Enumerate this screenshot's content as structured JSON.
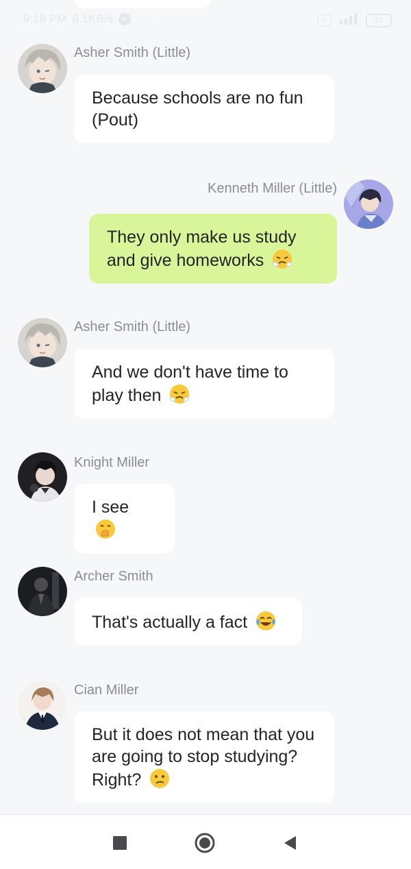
{
  "status_bar": {
    "time": "9:18 PM",
    "speed": "8.1KB/s",
    "dots": "···",
    "battery": "92"
  },
  "messages": [
    {
      "sender": "Asher Smith (Little)",
      "text": "Because schools are no fun (Pout)",
      "emoji": "",
      "side": "left",
      "avatar": "asher-avatar"
    },
    {
      "sender": "Kenneth Miller (Little)",
      "text": "They only make us study and give homeworks",
      "emoji": "steaming-angry-face-emoji",
      "side": "right",
      "avatar": "kenneth-avatar"
    },
    {
      "sender": "Asher Smith (Little)",
      "text": "And we don't have time to play then",
      "emoji": "steaming-angry-face-emoji",
      "side": "left",
      "avatar": "asher-avatar"
    },
    {
      "sender": "Knight Miller",
      "text": "I see",
      "emoji": "hand-over-mouth-emoji",
      "side": "left",
      "avatar": "knight-avatar"
    },
    {
      "sender": "Archer Smith",
      "text": "That's actually a fact",
      "emoji": "laughing-tears-emoji",
      "side": "left",
      "avatar": "archer-avatar"
    },
    {
      "sender": "Cian Miller",
      "text": "But it does not mean that you are going to stop studying? Right?",
      "emoji": "confused-face-emoji",
      "side": "left",
      "avatar": "cian-avatar"
    }
  ],
  "nav": {
    "recents": "square-icon",
    "home": "circle-icon",
    "back": "triangle-back-icon"
  },
  "colors": {
    "background": "#f6f7f9",
    "bubble_other": "#ffffff",
    "bubble_mine": "#d9f59a",
    "name_text": "#8b8d92"
  }
}
